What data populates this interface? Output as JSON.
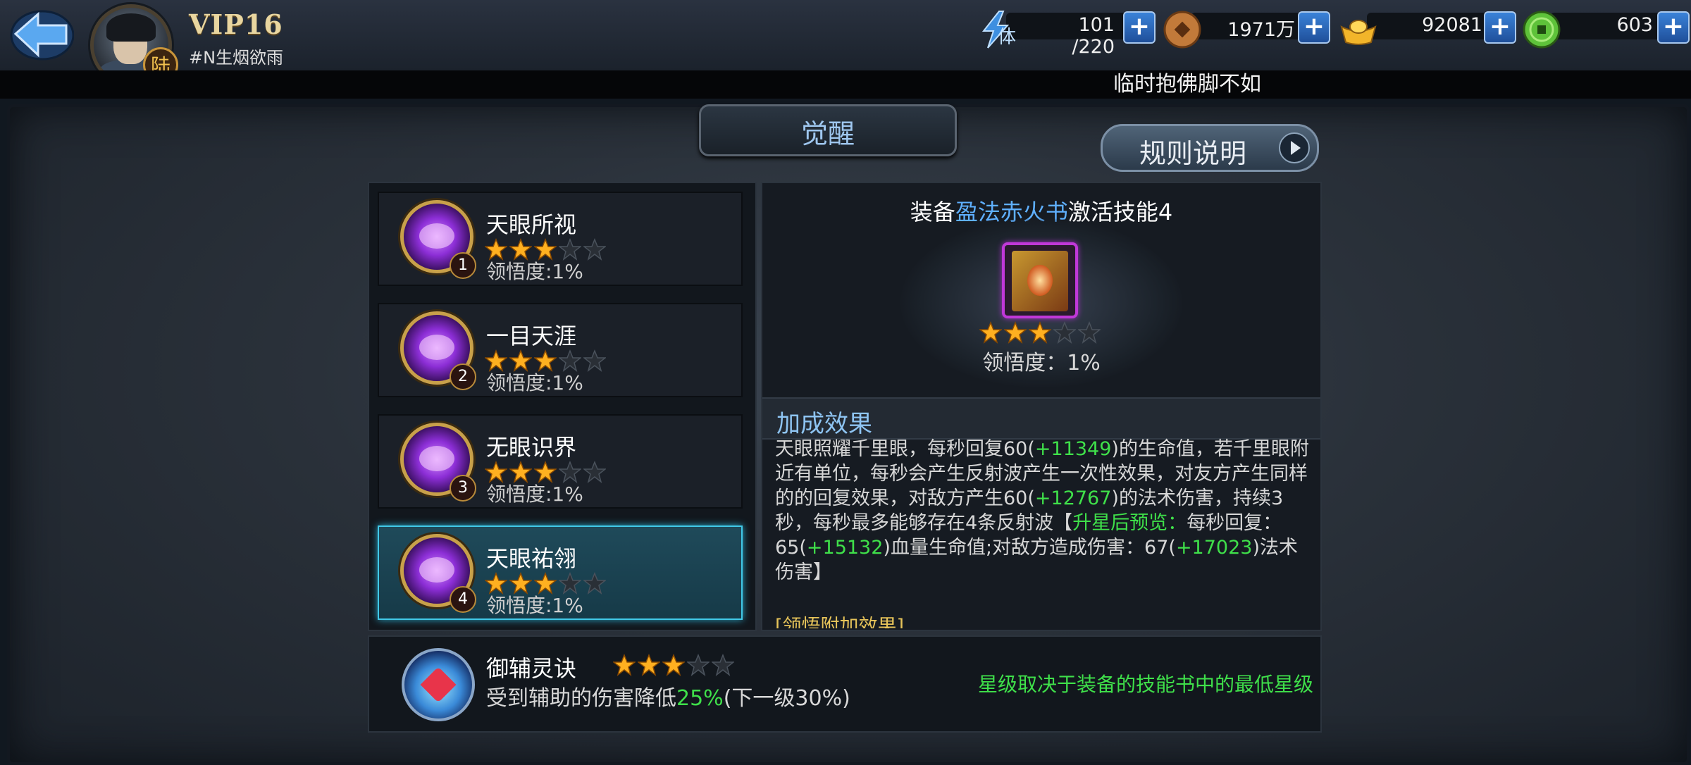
{
  "player": {
    "vip": "VIP16",
    "name": "#N生烟欲雨",
    "rank_badge": "陆"
  },
  "resources": {
    "stamina": {
      "icon": "lightning-stamina-icon",
      "label": "体",
      "value": "101 /220"
    },
    "copper": {
      "icon": "copper-coin-icon",
      "value": "1971万"
    },
    "gold": {
      "icon": "gold-ingot-icon",
      "value": "92081"
    },
    "jade": {
      "icon": "jade-coin-icon",
      "value": "603"
    }
  },
  "banner_text": "临时抱佛脚不如",
  "page_title": "觉醒",
  "rules_button": "规则说明",
  "skills": [
    {
      "name": "天眼所视",
      "index": "1",
      "stars": 3,
      "max_stars": 5,
      "comprehension": "领悟度:1%"
    },
    {
      "name": "一目天涯",
      "index": "2",
      "stars": 3,
      "max_stars": 5,
      "comprehension": "领悟度:1%"
    },
    {
      "name": "无眼识界",
      "index": "3",
      "stars": 3,
      "max_stars": 5,
      "comprehension": "领悟度:1%"
    },
    {
      "name": "天眼祐翎",
      "index": "4",
      "stars": 3,
      "max_stars": 5,
      "comprehension": "领悟度:1%",
      "selected": true
    }
  ],
  "detail": {
    "title_prefix": "装备",
    "title_book": "盈法赤火书",
    "title_suffix": "激活技能4",
    "stars": 3,
    "max_stars": 5,
    "comprehension": "领悟度：1%",
    "bonus_header": "加成效果",
    "description": {
      "p1": "天眼照耀千里眼，每秒回复60(",
      "v1": "+11349",
      "p2": ")的生命值，若千里眼附近有单位，每秒会产生反射波产生一次性效果，对友方产生同样的的回复效果，对敌方产生60(",
      "v2": "+12767",
      "p3": ")的法术伤害，持续3秒，每秒最多能够存在4条反射波【",
      "preview": "升星后预览：",
      "p4": "每秒回复：65(",
      "v3": "+15132",
      "p5": ")血量生命值;对敌方造成伤害：67(",
      "v4": "+17023",
      "p6": ")法术伤害】"
    },
    "more_header": "[领悟附加效果]"
  },
  "aux_skill": {
    "name": "御辅灵诀",
    "stars": 3,
    "max_stars": 5,
    "desc_prefix": "受到辅助的伤害降低",
    "desc_value": "25%",
    "desc_suffix": "(下一级30%)",
    "note": "星级取决于装备的技能书中的最低星级"
  },
  "colors": {
    "highlight_green": "#3fe04a",
    "book_blue": "#5fb0ff",
    "star_gold": "#ffb020",
    "selected_border": "#41c9e8"
  }
}
